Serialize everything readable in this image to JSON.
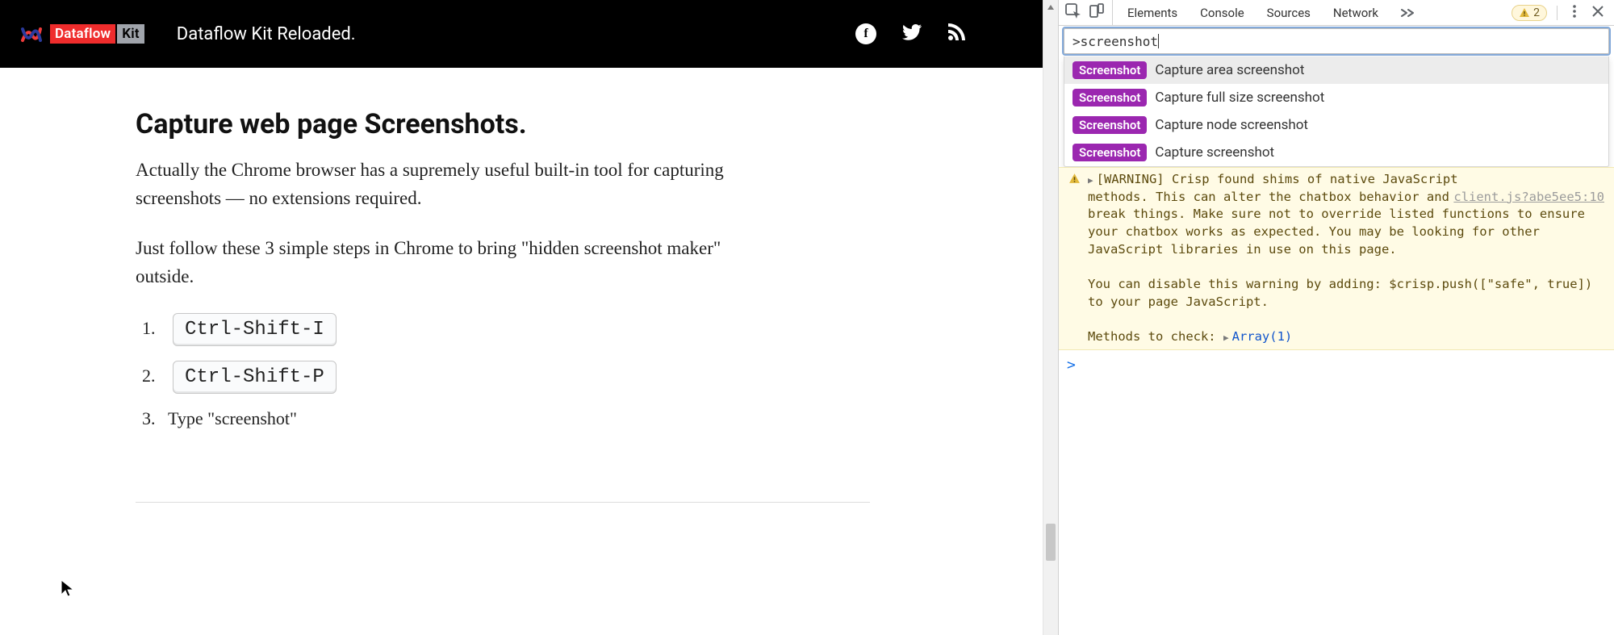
{
  "nav": {
    "logo_red": "Dataflow",
    "logo_grey": "Kit",
    "title": "Dataflow Kit Reloaded."
  },
  "article": {
    "heading": "Capture web page Screenshots.",
    "p1": "Actually the Chrome browser has a supremely useful built-in tool for capturing screenshots — no extensions required.",
    "p2": "Just follow these 3 simple steps in Chrome to bring \"hidden screenshot maker\" outside.",
    "steps": {
      "k1": "Ctrl-Shift-I",
      "k2": "Ctrl-Shift-P",
      "s3": "Type \"screenshot\""
    }
  },
  "devtools": {
    "tabs": {
      "elements": "Elements",
      "console": "Console",
      "sources": "Sources",
      "network": "Network"
    },
    "warningCount": "2",
    "command": ">screenshot",
    "suggestions": {
      "badge": "Screenshot",
      "s0": "Capture area screenshot",
      "s1": "Capture full size screenshot",
      "s2": "Capture node screenshot",
      "s3": "Capture screenshot"
    },
    "console": {
      "warnTag": "[WARNING]",
      "warnHead": " Crisp found shims of native JavaScript ",
      "srcRef": "client.js?abe5ee5:10",
      "warnBody": "methods. This can alter the chatbox behavior and break things. Make sure not to override listed functions to ensure your chatbox works as expected. You may be looking for other JavaScript libraries in use on this page.",
      "warnDisable": "You can disable this warning by adding: $crisp.push([\"safe\", true]) to your page JavaScript.",
      "methods": "Methods to check: ",
      "arrayLabel": "Array(1)",
      "prompt": ">"
    }
  }
}
